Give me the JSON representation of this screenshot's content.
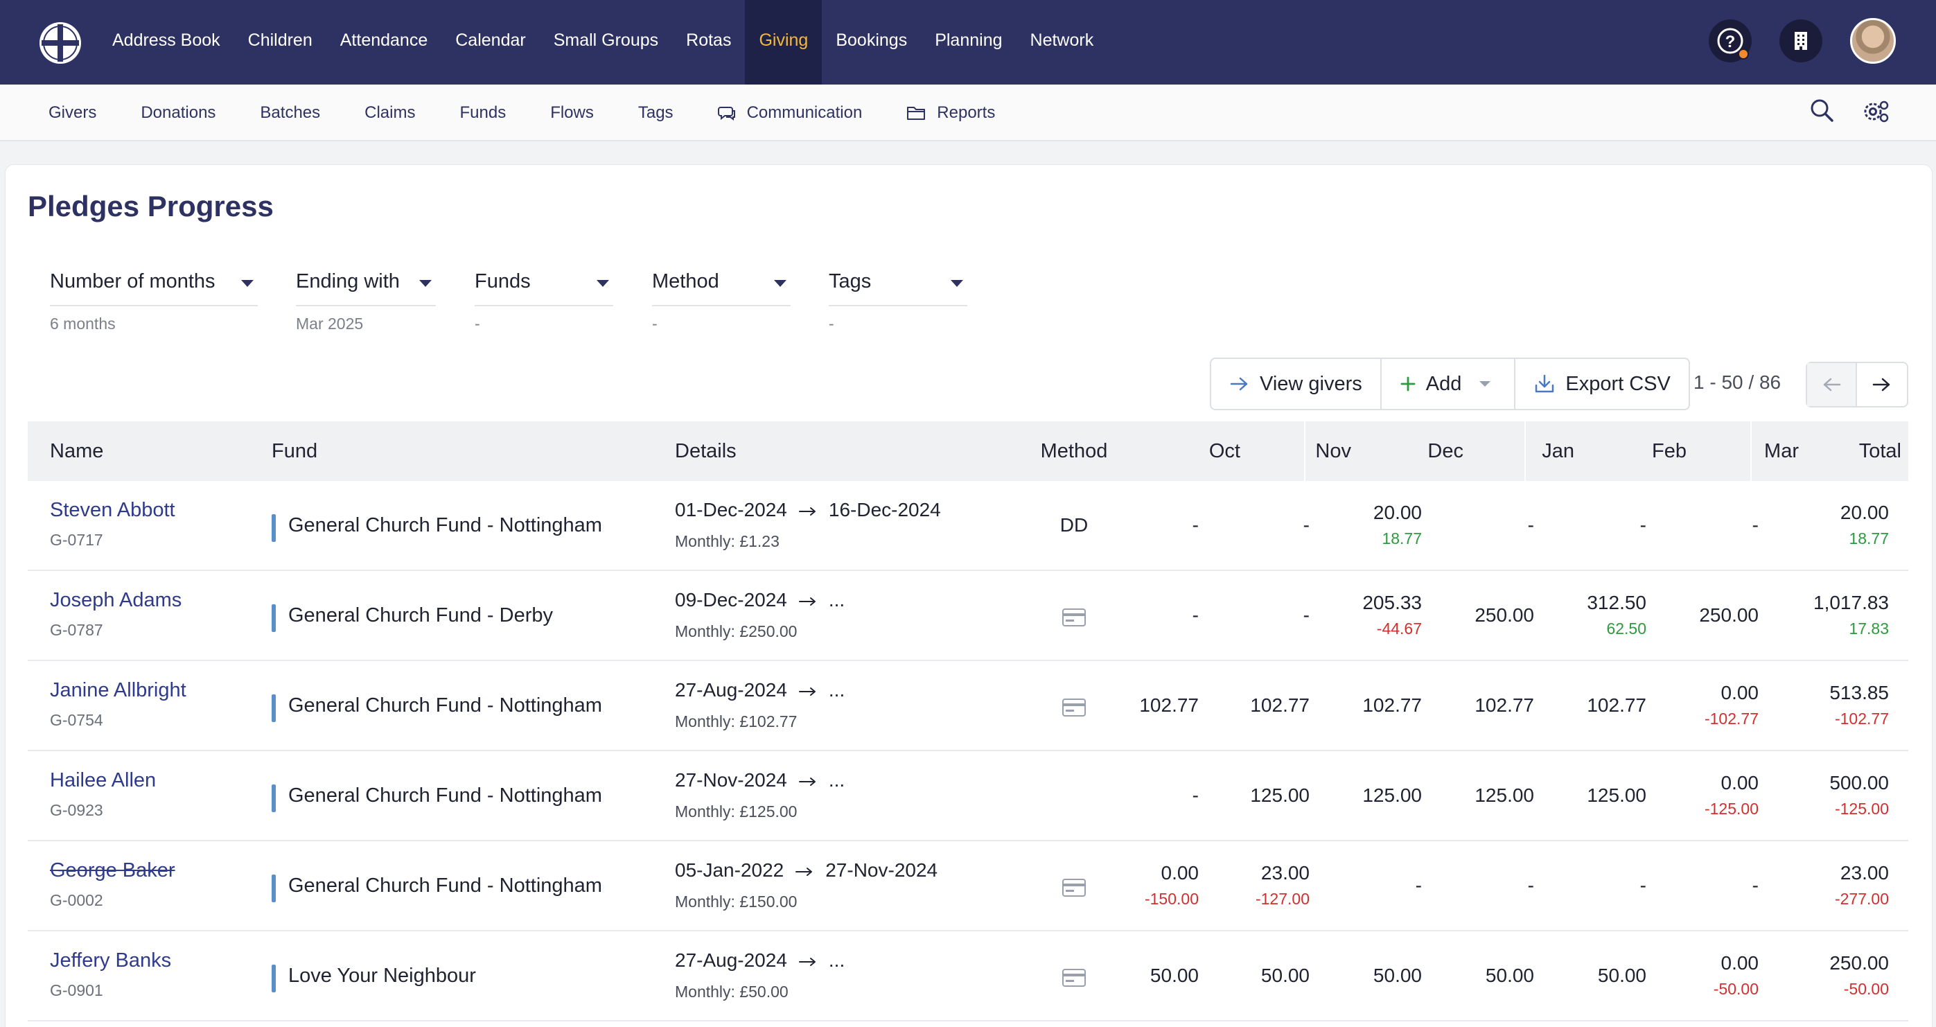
{
  "topnav": {
    "items": [
      {
        "label": "Address Book",
        "active": false
      },
      {
        "label": "Children",
        "active": false
      },
      {
        "label": "Attendance",
        "active": false
      },
      {
        "label": "Calendar",
        "active": false
      },
      {
        "label": "Small Groups",
        "active": false
      },
      {
        "label": "Rotas",
        "active": false
      },
      {
        "label": "Giving",
        "active": true
      },
      {
        "label": "Bookings",
        "active": false
      },
      {
        "label": "Planning",
        "active": false
      },
      {
        "label": "Network",
        "active": false
      }
    ],
    "icons": [
      "church-logo-icon",
      "help-icon",
      "building-icon",
      "user-avatar"
    ]
  },
  "subnav": {
    "items": [
      {
        "label": "Givers",
        "icon": ""
      },
      {
        "label": "Donations",
        "icon": ""
      },
      {
        "label": "Batches",
        "icon": ""
      },
      {
        "label": "Claims",
        "icon": ""
      },
      {
        "label": "Funds",
        "icon": ""
      },
      {
        "label": "Flows",
        "icon": ""
      },
      {
        "label": "Tags",
        "icon": ""
      },
      {
        "label": "Communication",
        "icon": "chat-icon"
      },
      {
        "label": "Reports",
        "icon": "folder-icon"
      }
    ]
  },
  "page": {
    "title": "Pledges Progress"
  },
  "filters": [
    {
      "label": "Number of months",
      "value": "6 months"
    },
    {
      "label": "Ending with",
      "value": "Mar 2025"
    },
    {
      "label": "Funds",
      "value": "-"
    },
    {
      "label": "Method",
      "value": "-"
    },
    {
      "label": "Tags",
      "value": "-"
    }
  ],
  "toolbar": {
    "view_givers": "View givers",
    "add": "Add",
    "export_csv": "Export CSV",
    "pager_text": "1 - 50 / 86"
  },
  "table": {
    "columns": [
      "Name",
      "Fund",
      "Details",
      "Method",
      "Oct",
      "Nov",
      "Dec",
      "Jan",
      "Feb",
      "Mar",
      "Total"
    ],
    "rows": [
      {
        "name": "Steven Abbott",
        "id": "G-0717",
        "lapsed": false,
        "fund": "General Church Fund - Nottingham",
        "start": "01-Dec-2024",
        "end": "16-Dec-2024",
        "monthly": "Monthly: £1.23",
        "method": "DD",
        "months": [
          {
            "v": "-",
            "d": ""
          },
          {
            "v": "-",
            "d": ""
          },
          {
            "v": "20.00",
            "d": "18.77",
            "s": "pos"
          },
          {
            "v": "-",
            "d": ""
          },
          {
            "v": "-",
            "d": ""
          },
          {
            "v": "-",
            "d": ""
          }
        ],
        "total": {
          "v": "20.00",
          "d": "18.77",
          "s": "pos"
        }
      },
      {
        "name": "Joseph Adams",
        "id": "G-0787",
        "lapsed": false,
        "fund": "General Church Fund - Derby",
        "start": "09-Dec-2024",
        "end": "...",
        "monthly": "Monthly: £250.00",
        "method": "card",
        "months": [
          {
            "v": "-",
            "d": ""
          },
          {
            "v": "-",
            "d": ""
          },
          {
            "v": "205.33",
            "d": "-44.67",
            "s": "neg"
          },
          {
            "v": "250.00",
            "d": ""
          },
          {
            "v": "312.50",
            "d": "62.50",
            "s": "pos"
          },
          {
            "v": "250.00",
            "d": ""
          }
        ],
        "total": {
          "v": "1,017.83",
          "d": "17.83",
          "s": "pos"
        }
      },
      {
        "name": "Janine Allbright",
        "id": "G-0754",
        "lapsed": false,
        "fund": "General Church Fund - Nottingham",
        "start": "27-Aug-2024",
        "end": "...",
        "monthly": "Monthly: £102.77",
        "method": "card",
        "months": [
          {
            "v": "102.77",
            "d": ""
          },
          {
            "v": "102.77",
            "d": ""
          },
          {
            "v": "102.77",
            "d": ""
          },
          {
            "v": "102.77",
            "d": ""
          },
          {
            "v": "102.77",
            "d": ""
          },
          {
            "v": "0.00",
            "d": "-102.77",
            "s": "neg"
          }
        ],
        "total": {
          "v": "513.85",
          "d": "-102.77",
          "s": "neg"
        }
      },
      {
        "name": "Hailee Allen",
        "id": "G-0923",
        "lapsed": false,
        "fund": "General Church Fund - Nottingham",
        "start": "27-Nov-2024",
        "end": "...",
        "monthly": "Monthly: £125.00",
        "method": "",
        "months": [
          {
            "v": "-",
            "d": ""
          },
          {
            "v": "125.00",
            "d": ""
          },
          {
            "v": "125.00",
            "d": ""
          },
          {
            "v": "125.00",
            "d": ""
          },
          {
            "v": "125.00",
            "d": ""
          },
          {
            "v": "0.00",
            "d": "-125.00",
            "s": "neg"
          }
        ],
        "total": {
          "v": "500.00",
          "d": "-125.00",
          "s": "neg"
        }
      },
      {
        "name": "George Baker",
        "id": "G-0002",
        "lapsed": true,
        "fund": "General Church Fund - Nottingham",
        "start": "05-Jan-2022",
        "end": "27-Nov-2024",
        "monthly": "Monthly: £150.00",
        "method": "card",
        "months": [
          {
            "v": "0.00",
            "d": "-150.00",
            "s": "neg"
          },
          {
            "v": "23.00",
            "d": "-127.00",
            "s": "neg"
          },
          {
            "v": "-",
            "d": ""
          },
          {
            "v": "-",
            "d": ""
          },
          {
            "v": "-",
            "d": ""
          },
          {
            "v": "-",
            "d": ""
          }
        ],
        "total": {
          "v": "23.00",
          "d": "-277.00",
          "s": "neg"
        }
      },
      {
        "name": "Jeffery Banks",
        "id": "G-0901",
        "lapsed": false,
        "fund": "Love Your Neighbour",
        "start": "27-Aug-2024",
        "end": "...",
        "monthly": "Monthly: £50.00",
        "method": "card",
        "months": [
          {
            "v": "50.00",
            "d": ""
          },
          {
            "v": "50.00",
            "d": ""
          },
          {
            "v": "50.00",
            "d": ""
          },
          {
            "v": "50.00",
            "d": ""
          },
          {
            "v": "50.00",
            "d": ""
          },
          {
            "v": "0.00",
            "d": "-50.00",
            "s": "neg"
          }
        ],
        "total": {
          "v": "250.00",
          "d": "-50.00",
          "s": "neg"
        }
      }
    ]
  },
  "colors": {
    "navy": "#2e3262",
    "active_tab_text": "#f2b93b",
    "link": "#2e3a8c",
    "positive": "#2c9a3e",
    "negative": "#d22f2f",
    "fund_bar": "#5b8fc9"
  }
}
